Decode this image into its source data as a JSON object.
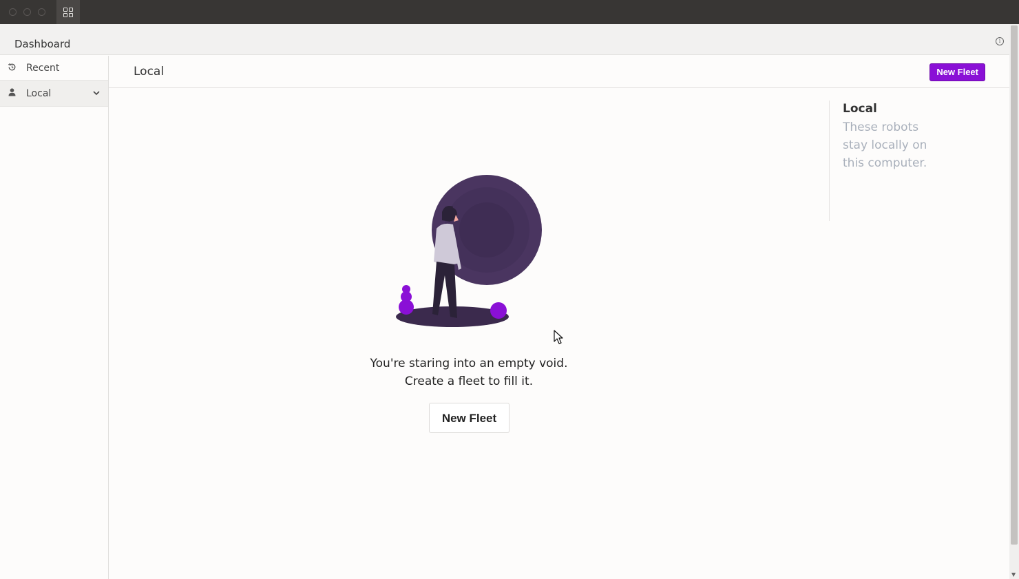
{
  "titlebar": {
    "apps_icon": "apps-grid-icon"
  },
  "header": {
    "title": "Dashboard",
    "info_icon": "info-icon"
  },
  "sidebar": {
    "items": [
      {
        "label": "Recent",
        "icon": "history-icon",
        "active": false
      },
      {
        "label": "Local",
        "icon": "user-icon",
        "active": true,
        "expand_icon": "chevron-down-icon"
      }
    ]
  },
  "main": {
    "title": "Local",
    "new_fleet_label": "New Fleet",
    "accent_color": "#8a10d6"
  },
  "info_panel": {
    "title": "Local",
    "description": "These robots stay locally on this computer."
  },
  "empty_state": {
    "line1": "You're staring into an empty void.",
    "line2": "Create a fleet to fill it.",
    "button_label": "New Fleet"
  }
}
